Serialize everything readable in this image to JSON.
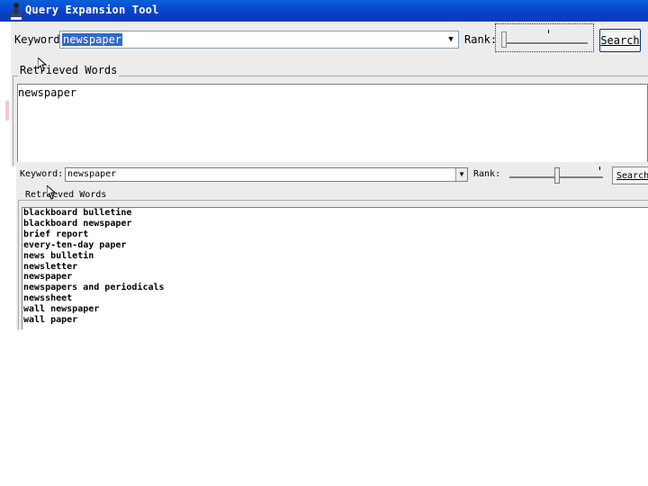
{
  "window": {
    "title": "Query Expansion Tool",
    "title_bar_color": "#0840c8"
  },
  "panel_top": {
    "keyword_label": "Keyword:",
    "keyword_value": "newspaper",
    "rank_label": "Rank:",
    "search_label": "Search",
    "group_title": "Retrieved Words",
    "results": [
      "newspaper"
    ]
  },
  "panel_bottom": {
    "keyword_label": "Keyword:",
    "keyword_value": "newspaper",
    "rank_label": "Rank:",
    "search_label": "Search",
    "group_title": "Retrieved Words",
    "results": [
      "blackboard bulletine",
      "blackboard newspaper",
      "brief report",
      "every-ten-day paper",
      "news bulletin",
      "newsletter",
      "newspaper",
      "newspapers and periodicals",
      "newssheet",
      "wall newspaper",
      "wall paper"
    ]
  },
  "icons": {
    "app": "app-icon",
    "dropdown": "chevron-down-icon",
    "cursor": "mouse-cursor-icon"
  },
  "colors": {
    "selection": "#316ac5",
    "panel_bg": "#ececec"
  }
}
